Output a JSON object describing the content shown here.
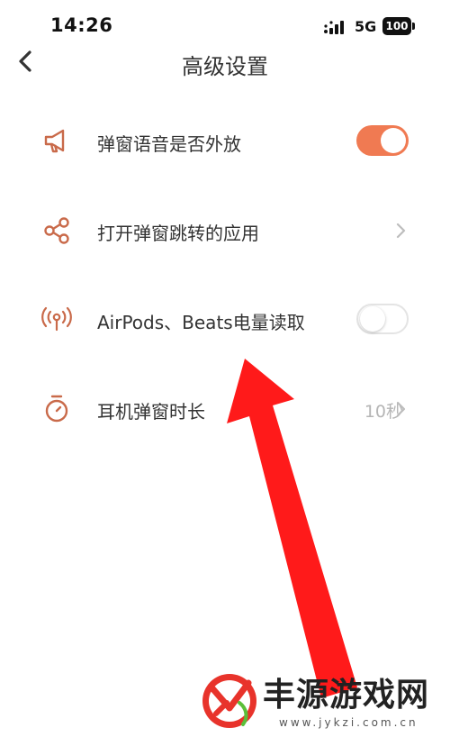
{
  "status_bar": {
    "time": "14:26",
    "network": "5G",
    "battery": "100"
  },
  "header": {
    "title": "高级设置",
    "back_icon": "chevron-left-icon"
  },
  "settings": [
    {
      "label": "弹窗语音是否外放",
      "icon": "megaphone-icon",
      "control": "toggle",
      "toggle_on": true
    },
    {
      "label": "打开弹窗跳转的应用",
      "icon": "share-icon",
      "control": "chevron"
    },
    {
      "label": "AirPods、Beats电量读取",
      "icon": "broadcast-icon",
      "control": "toggle",
      "toggle_on": false
    },
    {
      "label": "耳机弹窗时长",
      "icon": "timer-icon",
      "control": "value-chevron",
      "value": "10秒"
    }
  ],
  "colors": {
    "accent": "#f07a52",
    "icon": "#c96a4a",
    "annotation_arrow": "#ff1a1a"
  },
  "watermark": {
    "brand": "丰源游戏网",
    "url": "www.jykzi.com.cn"
  }
}
